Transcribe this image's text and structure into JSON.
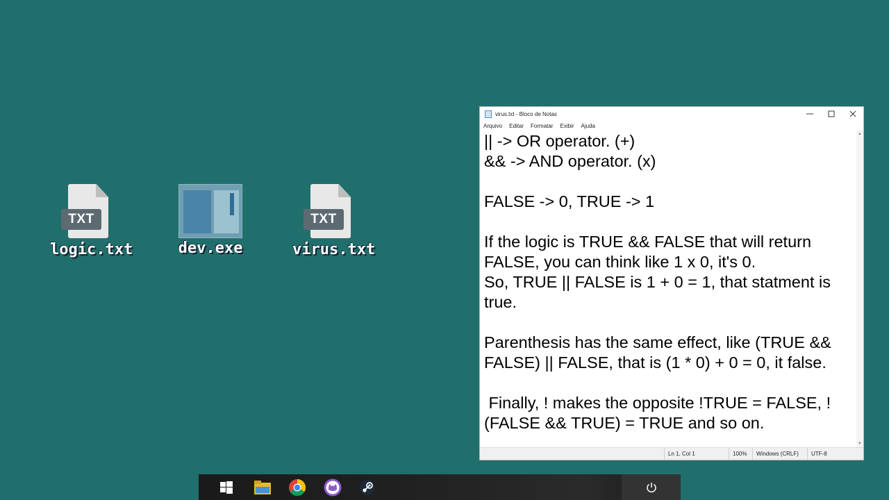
{
  "desktop": {
    "icons": [
      {
        "label": "logic.txt",
        "badge": "TXT"
      },
      {
        "label": "dev.exe"
      },
      {
        "label": "virus.txt",
        "badge": "TXT"
      }
    ]
  },
  "notepad": {
    "title": "virus.txt - Bloco de Notas",
    "menu": [
      "Arquivo",
      "Editar",
      "Formatar",
      "Exibir",
      "Ajuda"
    ],
    "content": "|| -> OR operator. (+)\n&& -> AND operator. (x)\n\nFALSE -> 0, TRUE -> 1\n\nIf the logic is TRUE && FALSE that will return FALSE, you can think like 1 x 0, it's 0.\nSo, TRUE || FALSE is 1 + 0 = 1, that statment is true.\n\nParenthesis has the same effect, like (TRUE && FALSE) || FALSE, that is (1 * 0) + 0 = 0, it false.\n\n Finally, ! makes the opposite !TRUE = FALSE, !(FALSE && TRUE) = TRUE and so on.",
    "status": {
      "position": "Ln 1, Col 1",
      "zoom": "100%",
      "line_ending": "Windows (CRLF)",
      "encoding": "UTF-8"
    }
  },
  "taskbar": {
    "items": [
      "windows-start-icon",
      "file-explorer-icon",
      "chrome-icon",
      "cat-app-icon",
      "steam-icon"
    ],
    "power": "power-icon"
  },
  "colors": {
    "desktop_bg": "#216f6c",
    "taskbar_bg": "#1e1e1e",
    "txt_badge": "#5d6a72"
  }
}
